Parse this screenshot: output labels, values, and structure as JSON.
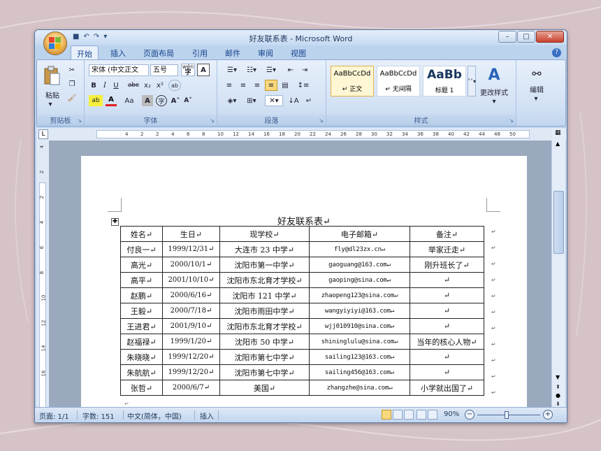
{
  "window": {
    "title": "好友联系表 - Microsoft Word",
    "controls": [
      "minimize-icon",
      "maximize-icon",
      "close-icon"
    ]
  },
  "ribbon_tabs": [
    "开始",
    "插入",
    "页面布局",
    "引用",
    "邮件",
    "审阅",
    "视图"
  ],
  "ribbon": {
    "clipboard": {
      "paste_label": "粘贴",
      "group_label": "剪贴板"
    },
    "font": {
      "font_name": "宋体 (中文正文",
      "font_size": "五号",
      "group_label": "字体",
      "phonetic_char": "wén"
    },
    "paragraph": {
      "group_label": "段落"
    },
    "styles": {
      "group_label": "样式",
      "items": [
        {
          "preview": "AaBbCcDd",
          "name": "↵ 正文"
        },
        {
          "preview": "AaBbCcDd",
          "name": "↵ 无间隔"
        },
        {
          "preview": "AaBb",
          "name": "标题 1"
        }
      ],
      "change_styles": "更改样式"
    },
    "editing": {
      "label": "编辑"
    }
  },
  "ruler": {
    "numbers": [
      "4",
      "2",
      "2",
      "4",
      "6",
      "8",
      "10",
      "12",
      "14",
      "16",
      "18",
      "20",
      "22",
      "24",
      "26",
      "28",
      "30",
      "32",
      "34",
      "36",
      "38",
      "40",
      "42",
      "44",
      "48",
      "50"
    ],
    "v_numbers": [
      "4",
      "2",
      "2",
      "4",
      "6",
      "8",
      "10",
      "12",
      "14",
      "16"
    ]
  },
  "document": {
    "title": "好友联系表↵",
    "table": {
      "headers": [
        "姓名↵",
        "生日↵",
        "现学校↵",
        "电子邮箱↵",
        "备注↵"
      ],
      "rows": [
        [
          "付良一↵",
          "1999/12/31↵",
          "大连市 23 中学↵",
          "fly@dl23zx.cn↵",
          "举家迁走↵"
        ],
        [
          "高光↵",
          "2000/10/1↵",
          "沈阳市第一中学↵",
          "gaoguang@163.com↵",
          "刚升班长了↵"
        ],
        [
          "高平↵",
          "2001/10/10↵",
          "沈阳市东北育才学校↵",
          "gaoping@sina.com↵",
          "↵"
        ],
        [
          "赵鹏↵",
          "2000/6/16↵",
          "沈阳市 121 中学↵",
          "zhaopeng123@sina.com↵",
          "↵"
        ],
        [
          "王毅↵",
          "2000/7/18↵",
          "沈阳市雨田中学↵",
          "wangyiyiyi@163.com↵",
          "↵"
        ],
        [
          "王进君↵",
          "2001/9/10↵",
          "沈阳市东北育才学校↵",
          "wjj010910@sina.com↵",
          "↵"
        ],
        [
          "赵福禄↵",
          "1999/1/20↵",
          "沈阳市 50 中学↵",
          "shininglulu@sina.com↵",
          "当年的核心人物↵"
        ],
        [
          "朱晓晓↵",
          "1999/12/20↵",
          "沈阳市第七中学↵",
          "sailing123@163.com↵",
          "↵"
        ],
        [
          "朱航航↵",
          "1999/12/20↵",
          "沈阳市第七中学↵",
          "sailing456@163.com↵",
          "↵"
        ],
        [
          "张哲↵",
          "2000/6/7↵",
          "美国↵",
          "zhangzhe@sina.com↵",
          "小学就出国了↵"
        ]
      ],
      "row_end_mark": "↵"
    },
    "trailing_mark": "↵"
  },
  "status_bar": {
    "page": "页面: 1/1",
    "words": "字数: 151",
    "language": "中文(简体，中国)",
    "mode": "插入",
    "zoom": "90%"
  },
  "colors": {
    "background": "#d6c3c8",
    "ribbon": "#d2e1f4",
    "window_frame": "#bcd3ee"
  }
}
